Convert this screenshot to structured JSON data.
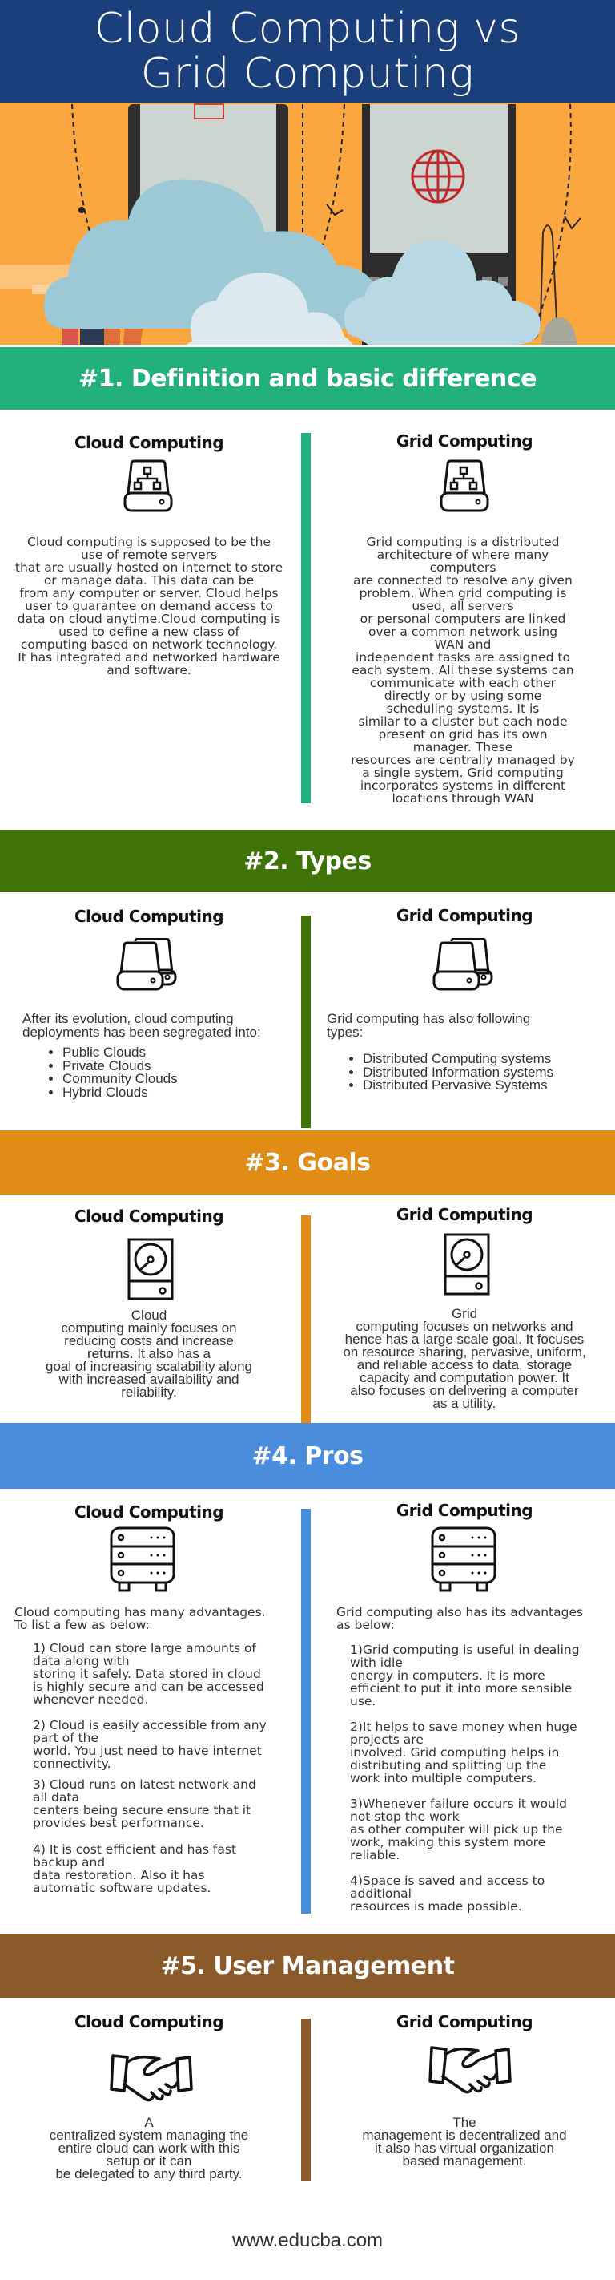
{
  "hero": {
    "title_line1": "Cloud Computing vs",
    "title_line2": "Grid Computing",
    "illustration": "cloud-devices-illustration",
    "colors": {
      "band": "#1b3f7a",
      "background": "#f9a73e"
    }
  },
  "columns": {
    "left_title": "Cloud Computing",
    "right_title": "Grid Computing"
  },
  "sections": [
    {
      "heading": "#1. Definition and basic difference",
      "color": "#22b07d",
      "icon": "network-drive-icon",
      "left_text": "Cloud computing is supposed to be the\nuse of remote servers\nthat are usually hosted on internet to store\nor manage data. This data can be\nfrom any computer or server. Cloud helps\nuser to guarantee on demand access to\ndata on cloud anytime.Cloud computing is\nused to define a new class of\ncomputing based on network technology.\nIt has integrated and networked hardware\nand software.",
      "right_text": "Grid computing is a distributed\narchitecture of where many\ncomputers\nare connected to resolve any given\nproblem. When grid computing is\nused, all servers\nor personal computers are linked\nover a common network using\nWAN and\nindependent tasks are assigned to\neach system. All these systems can\ncommunicate with each other\ndirectly or by using some\nscheduling systems. It is\nsimilar to a cluster but each node\npresent on grid has its own\nmanager. These\nresources are centrally managed by\na single system. Grid computing\nincorporates systems in different\nlocations through WAN"
    },
    {
      "heading": "#2. Types",
      "color": "#3f7307",
      "icon": "hard-drives-icon",
      "left_intro": "After its evolution, cloud computing\ndeployments has been segregated into:",
      "left_items": [
        "Public Clouds",
        "Private Clouds",
        "Community Clouds",
        "Hybrid Clouds"
      ],
      "right_intro": "Grid computing has also following\ntypes:",
      "right_items": [
        "Distributed Computing systems",
        "Distributed Information systems",
        "Distributed Pervasive Systems"
      ]
    },
    {
      "heading": "#3. Goals",
      "color": "#e08c15",
      "icon": "hard-disk-icon",
      "left_text": "Cloud\ncomputing mainly focuses on\nreducing costs and increase\nreturns. It also has a\ngoal of increasing scalability along\nwith increased availability and\nreliability.",
      "right_text": "Grid\ncomputing focuses on networks and\nhence has a large scale goal. It focuses\non resource sharing, pervasive, uniform,\nand reliable access to data, storage\ncapacity and computation power. It\nalso focuses on delivering a computer\nas a utility."
    },
    {
      "heading": "#4. Pros",
      "color": "#4a8ddc",
      "icon": "server-rack-icon",
      "left_intro": "Cloud computing has many advantages.\nTo list a few as below:",
      "left_items": [
        "1) Cloud can store large amounts of\ndata along with\nstoring it safely. Data stored in cloud\nis highly secure and can be accessed\nwhenever needed.",
        "2) Cloud is easily accessible from any\npart of the\nworld. You just need to have internet\nconnectivity.",
        "3) Cloud runs on latest network and\nall data\ncenters being secure ensure that it\nprovides best performance.",
        "4) It is cost efficient and has fast\nbackup and\ndata restoration. Also it has\nautomatic software updates."
      ],
      "right_intro": "Grid computing also has its advantages\nas below:",
      "right_items": [
        "1)Grid computing is useful in dealing\nwith idle\nenergy in computers. It is more\nefficient to put it into more sensible\nuse.",
        "2)It helps to save money when huge\nprojects are\ninvolved. Grid computing helps in\ndistributing and splitting up the\nwork into multiple computers.",
        "3)Whenever failure occurs it would\nnot stop the work\nas other computer will pick up the\nwork, making this system more\nreliable.",
        "4)Space is saved and access to\nadditional\nresources is made possible."
      ]
    },
    {
      "heading": "#5. User Management",
      "color": "#8b5a2b",
      "icon": "handshake-icon",
      "left_text": "A\ncentralized system managing the\nentire cloud can work with this\nsetup or it can\nbe delegated to any third party.",
      "right_text": "The\nmanagement is decentralized and\nit also has virtual organization\nbased management."
    }
  ],
  "footer": {
    "url": "www.educba.com"
  }
}
